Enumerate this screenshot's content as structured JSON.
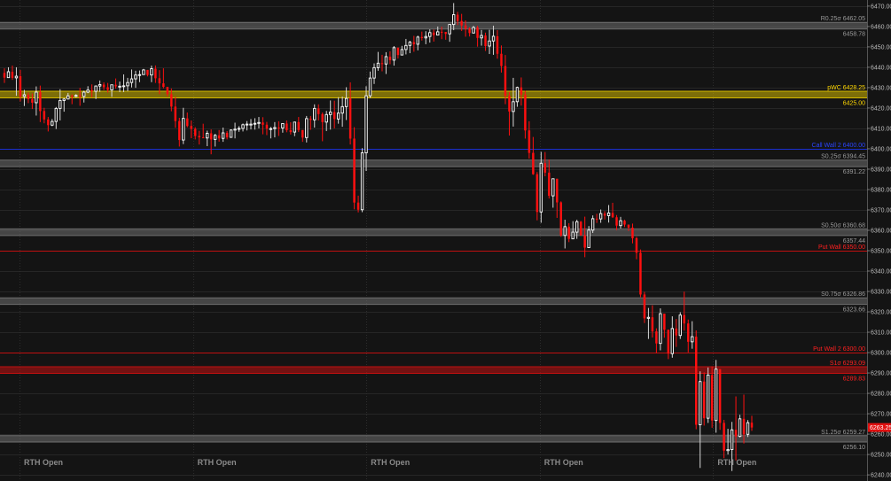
{
  "chart_data": {
    "type": "candlestick",
    "ylim": [
      6237,
      6473
    ],
    "y_ticks": [
      6470,
      6460,
      6450,
      6440,
      6430,
      6420,
      6410,
      6400,
      6390,
      6380,
      6370,
      6360,
      6350,
      6340,
      6330,
      6320,
      6310,
      6300,
      6290,
      6280,
      6270,
      6260,
      6250,
      6240
    ],
    "y_tick_labels": [
      "6470.00",
      "6460.00",
      "6450.00",
      "6440.00",
      "6430.00",
      "6420.00",
      "6410.00",
      "6400.00",
      "6390.00",
      "6380.00",
      "6370.00",
      "6360.00",
      "6350.00",
      "6340.00",
      "6330.00",
      "6320.00",
      "6310.00",
      "6300.00",
      "6290.00",
      "6280.00",
      "6270.00",
      "6260.00",
      "6250.00",
      "6240.00"
    ],
    "last_price": 6263.25,
    "last_price_label": "6263.25",
    "grid": true,
    "session_label": "RTH Open",
    "session_count": 5,
    "levels": [
      {
        "label": "R0.25σ  6462.05",
        "value": 6462.05,
        "color": "#6e6e6e",
        "kind": "band",
        "band_to": 6458.78,
        "text_color": "#9a9a9a"
      },
      {
        "label": "6458.78",
        "value": 6458.78,
        "color": "#6e6e6e",
        "kind": "label",
        "text_color": "#9a9a9a"
      },
      {
        "label": "pWC  6428.25",
        "value": 6428.25,
        "color": "#d4b800",
        "kind": "band",
        "band_to": 6425.0,
        "text_color": "#ffd700"
      },
      {
        "label": "6425.00",
        "value": 6425.0,
        "color": "#d4b800",
        "kind": "label",
        "text_color": "#ffd700"
      },
      {
        "label": "Call Wall 2  6400.00",
        "value": 6400.0,
        "color": "#1a2fd0",
        "kind": "line",
        "text_color": "#2a44ff"
      },
      {
        "label": "S0.25σ  6394.45",
        "value": 6394.45,
        "color": "#6e6e6e",
        "kind": "band",
        "band_to": 6391.22,
        "text_color": "#9a9a9a"
      },
      {
        "label": "6391.22",
        "value": 6391.22,
        "color": "#6e6e6e",
        "kind": "label",
        "text_color": "#9a9a9a"
      },
      {
        "label": "S0.50σ  6360.68",
        "value": 6360.68,
        "color": "#6e6e6e",
        "kind": "band",
        "band_to": 6357.44,
        "text_color": "#9a9a9a"
      },
      {
        "label": "6357.44",
        "value": 6357.44,
        "color": "#6e6e6e",
        "kind": "label",
        "text_color": "#9a9a9a"
      },
      {
        "label": "Put Wall  6350.00",
        "value": 6350.0,
        "color": "#c01010",
        "kind": "line",
        "text_color": "#ff2020"
      },
      {
        "label": "S0.75σ  6326.86",
        "value": 6326.86,
        "color": "#6e6e6e",
        "kind": "band",
        "band_to": 6323.66,
        "text_color": "#9a9a9a"
      },
      {
        "label": "6323.66",
        "value": 6323.66,
        "color": "#6e6e6e",
        "kind": "label",
        "text_color": "#9a9a9a"
      },
      {
        "label": "Put Wall 2  6300.00",
        "value": 6300.0,
        "color": "#c01010",
        "kind": "line",
        "text_color": "#ff2020"
      },
      {
        "label": "S1σ  6293.09",
        "value": 6293.09,
        "color": "#c01010",
        "kind": "band",
        "band_to": 6289.83,
        "text_color": "#ff2020"
      },
      {
        "label": "6289.83",
        "value": 6289.83,
        "color": "#c01010",
        "kind": "label",
        "text_color": "#ff2020"
      },
      {
        "label": "S1.25σ  6259.27",
        "value": 6259.27,
        "color": "#6e6e6e",
        "kind": "band",
        "band_to": 6256.1,
        "text_color": "#9a9a9a"
      },
      {
        "label": "6256.10",
        "value": 6256.1,
        "color": "#6e6e6e",
        "kind": "label",
        "text_color": "#9a9a9a"
      }
    ],
    "candles": [
      [
        6437.2,
        6439.5,
        6432.3,
        6434.9
      ],
      [
        6434.9,
        6440.0,
        6434.9,
        6437.8
      ],
      [
        6437.8,
        6440.8,
        6433.8,
        6434.8
      ],
      [
        6434.8,
        6440.0,
        6426.0,
        6435.6
      ],
      [
        6435.6,
        6438.7,
        6423.2,
        6425.7
      ],
      [
        6425.7,
        6428.9,
        6421.0,
        6426.5
      ],
      [
        6426.5,
        6427.6,
        6422.4,
        6424.4
      ],
      [
        6424.4,
        6427.1,
        6419.5,
        6422.6
      ],
      [
        6422.6,
        6430.6,
        6416.3,
        6427.8
      ],
      [
        6427.8,
        6431.0,
        6413.1,
        6418.5
      ],
      [
        6418.5,
        6420.1,
        6412.5,
        6414.4
      ],
      [
        6414.4,
        6415.6,
        6408.5,
        6411.6
      ],
      [
        6411.6,
        6414.6,
        6411.1,
        6413.4
      ],
      [
        6413.4,
        6420.5,
        6409.7,
        6419.8
      ],
      [
        6419.8,
        6429.2,
        6413.9,
        6423.7
      ],
      [
        6423.7,
        6424.9,
        6418.2,
        6424.4
      ],
      [
        6424.4,
        6427.4,
        6424.3,
        6426.0
      ],
      [
        6426.0,
        6426.7,
        6421.9,
        6425.7
      ],
      [
        6425.7,
        6426.8,
        6425.3,
        6426.2
      ],
      [
        6426.2,
        6429.9,
        6421.1,
        6425.7
      ],
      [
        6425.7,
        6428.5,
        6422.7,
        6427.8
      ],
      [
        6427.8,
        6430.7,
        6427.3,
        6428.8
      ],
      [
        6428.8,
        6431.6,
        6425.3,
        6428.2
      ],
      [
        6428.2,
        6431.1,
        6424.4,
        6430.8
      ],
      [
        6430.8,
        6433.5,
        6427.9,
        6431.5
      ],
      [
        6431.5,
        6432.6,
        6428.8,
        6430.2
      ],
      [
        6430.2,
        6432.3,
        6427.6,
        6428.9
      ],
      [
        6428.9,
        6431.5,
        6425.5,
        6431.4
      ],
      [
        6431.4,
        6434.5,
        6429.5,
        6430.6
      ],
      [
        6430.6,
        6433.0,
        6427.8,
        6430.7
      ],
      [
        6430.7,
        6436.5,
        6427.8,
        6430.9
      ],
      [
        6430.9,
        6434.8,
        6428.3,
        6432.5
      ],
      [
        6432.5,
        6438.9,
        6430.1,
        6434.3
      ],
      [
        6434.3,
        6438.3,
        6429.9,
        6436.2
      ],
      [
        6436.2,
        6438.4,
        6432.7,
        6436.4
      ],
      [
        6436.4,
        6439.2,
        6436.4,
        6438.7
      ],
      [
        6438.7,
        6438.7,
        6435.5,
        6436.2
      ],
      [
        6436.2,
        6440.8,
        6432.7,
        6439.3
      ],
      [
        6439.3,
        6440.9,
        6432.3,
        6434.6
      ],
      [
        6434.6,
        6438.6,
        6426.8,
        6432.1
      ],
      [
        6432.1,
        6439.5,
        6429.6,
        6430.4
      ],
      [
        6430.4,
        6430.4,
        6425.6,
        6426.8
      ],
      [
        6426.8,
        6429.6,
        6418.4,
        6420.7
      ],
      [
        6420.7,
        6425.5,
        6410.3,
        6413.6
      ],
      [
        6413.6,
        6415.2,
        6401.1,
        6404.3
      ],
      [
        6404.3,
        6420.1,
        6402.3,
        6414.9
      ],
      [
        6414.9,
        6417.8,
        6410.5,
        6411.2
      ],
      [
        6411.2,
        6413.9,
        6405.2,
        6409.8
      ],
      [
        6409.8,
        6410.6,
        6404.6,
        6406.3
      ],
      [
        6406.3,
        6408.8,
        6402.1,
        6405.6
      ],
      [
        6405.6,
        6412.3,
        6405.3,
        6405.3
      ],
      [
        6405.3,
        6408.9,
        6401.3,
        6407.6
      ],
      [
        6407.6,
        6409.5,
        6397.3,
        6404.6
      ],
      [
        6404.6,
        6407.3,
        6401.1,
        6406.6
      ],
      [
        6406.6,
        6409.2,
        6403.5,
        6405.1
      ],
      [
        6405.1,
        6410.4,
        6403.4,
        6407.8
      ],
      [
        6407.8,
        6408.7,
        6404.6,
        6405.6
      ],
      [
        6405.6,
        6409.5,
        6405.5,
        6409.2
      ],
      [
        6409.2,
        6412.8,
        6405.1,
        6409.6
      ],
      [
        6409.6,
        6411.1,
        6408.3,
        6410.0
      ],
      [
        6410.0,
        6412.4,
        6408.5,
        6411.8
      ],
      [
        6411.8,
        6413.6,
        6409.0,
        6412.1
      ],
      [
        6412.1,
        6414.6,
        6409.5,
        6412.1
      ],
      [
        6412.1,
        6415.0,
        6409.4,
        6412.5
      ],
      [
        6412.5,
        6415.6,
        6410.0,
        6412.9
      ],
      [
        6412.9,
        6415.5,
        6407.1,
        6411.8
      ],
      [
        6411.8,
        6413.2,
        6406.7,
        6409.9
      ],
      [
        6409.9,
        6410.7,
        6405.1,
        6409.9
      ],
      [
        6409.9,
        6413.1,
        6405.6,
        6410.4
      ],
      [
        6410.4,
        6413.5,
        6406.3,
        6410.2
      ],
      [
        6410.2,
        6412.4,
        6407.9,
        6412.4
      ],
      [
        6412.4,
        6413.9,
        6408.1,
        6409.1
      ],
      [
        6409.1,
        6413.0,
        6407.0,
        6408.2
      ],
      [
        6408.2,
        6413.1,
        6406.2,
        6413.1
      ],
      [
        6413.1,
        6415.6,
        6408.2,
        6409.2
      ],
      [
        6409.2,
        6409.2,
        6403.4,
        6405.5
      ],
      [
        6405.5,
        6416.1,
        6403.1,
        6414.8
      ],
      [
        6414.8,
        6416.1,
        6409.3,
        6414.2
      ],
      [
        6414.2,
        6421.8,
        6410.4,
        6419.8
      ],
      [
        6419.8,
        6421.8,
        6413.9,
        6417.0
      ],
      [
        6417.0,
        6417.8,
        6403.7,
        6413.1
      ],
      [
        6413.1,
        6418.6,
        6408.7,
        6416.8
      ],
      [
        6416.8,
        6423.7,
        6409.4,
        6418.0
      ],
      [
        6418.0,
        6423.6,
        6410.0,
        6414.6
      ],
      [
        6414.6,
        6425.3,
        6412.3,
        6417.5
      ],
      [
        6417.5,
        6425.6,
        6410.8,
        6420.7
      ],
      [
        6420.7,
        6430.2,
        6414.1,
        6424.7
      ],
      [
        6424.7,
        6432.6,
        6402.1,
        6405.0
      ],
      [
        6405.0,
        6410.6,
        6370.3,
        6373.6
      ],
      [
        6373.6,
        6377.0,
        6368.8,
        6370.1
      ],
      [
        6370.1,
        6400.3,
        6368.9,
        6398.0
      ],
      [
        6398.0,
        6430.7,
        6389.1,
        6426.0
      ],
      [
        6426.0,
        6437.9,
        6424.9,
        6434.7
      ],
      [
        6434.7,
        6441.9,
        6431.8,
        6439.8
      ],
      [
        6439.8,
        6447.5,
        6438.3,
        6442.0
      ],
      [
        6442.0,
        6446.1,
        6438.0,
        6441.6
      ],
      [
        6441.6,
        6447.4,
        6436.7,
        6445.2
      ],
      [
        6445.2,
        6447.8,
        6441.5,
        6443.5
      ],
      [
        6443.5,
        6450.4,
        6440.8,
        6449.6
      ],
      [
        6449.6,
        6449.7,
        6444.3,
        6446.0
      ],
      [
        6446.0,
        6450.5,
        6446.0,
        6448.7
      ],
      [
        6448.7,
        6453.9,
        6446.3,
        6450.7
      ],
      [
        6450.7,
        6453.0,
        6446.9,
        6452.3
      ],
      [
        6452.3,
        6455.4,
        6447.6,
        6451.3
      ],
      [
        6451.3,
        6455.5,
        6448.3,
        6454.8
      ],
      [
        6454.8,
        6457.5,
        6453.1,
        6454.4
      ],
      [
        6454.4,
        6457.7,
        6451.3,
        6455.1
      ],
      [
        6455.1,
        6458.6,
        6452.1,
        6457.0
      ],
      [
        6457.0,
        6458.5,
        6452.6,
        6455.8
      ],
      [
        6455.8,
        6460.0,
        6455.8,
        6457.4
      ],
      [
        6457.4,
        6459.9,
        6453.8,
        6457.3
      ],
      [
        6457.3,
        6457.3,
        6453.5,
        6456.4
      ],
      [
        6456.4,
        6461.0,
        6452.5,
        6461.0
      ],
      [
        6461.0,
        6471.5,
        6458.2,
        6465.8
      ],
      [
        6465.8,
        6467.2,
        6460.7,
        6462.7
      ],
      [
        6462.7,
        6466.2,
        6457.8,
        6460.5
      ],
      [
        6460.5,
        6463.0,
        6455.0,
        6459.0
      ],
      [
        6459.0,
        6459.6,
        6455.1,
        6456.8
      ],
      [
        6456.8,
        6460.3,
        6456.6,
        6459.5
      ],
      [
        6459.5,
        6460.4,
        6450.1,
        6454.4
      ],
      [
        6454.4,
        6458.3,
        6450.6,
        6455.6
      ],
      [
        6455.6,
        6457.0,
        6448.0,
        6450.4
      ],
      [
        6450.4,
        6458.4,
        6446.5,
        6452.9
      ],
      [
        6452.9,
        6460.4,
        6446.1,
        6455.2
      ],
      [
        6455.2,
        6458.2,
        6444.2,
        6446.6
      ],
      [
        6446.6,
        6450.7,
        6437.4,
        6440.6
      ],
      [
        6440.6,
        6446.0,
        6421.9,
        6426.0
      ],
      [
        6426.0,
        6427.9,
        6406.5,
        6418.3
      ],
      [
        6418.3,
        6434.8,
        6410.9,
        6423.1
      ],
      [
        6423.1,
        6430.5,
        6420.6,
        6430.1
      ],
      [
        6430.1,
        6435.0,
        6421.2,
        6426.6
      ],
      [
        6426.6,
        6428.4,
        6405.0,
        6409.0
      ],
      [
        6409.0,
        6413.5,
        6395.2,
        6398.0
      ],
      [
        6398.0,
        6405.8,
        6387.2,
        6387.5
      ],
      [
        6387.5,
        6388.6,
        6364.9,
        6369.0
      ],
      [
        6369.0,
        6398.5,
        6363.7,
        6392.9
      ],
      [
        6392.9,
        6398.4,
        6386.5,
        6388.3
      ],
      [
        6388.3,
        6394.7,
        6375.6,
        6376.9
      ],
      [
        6376.9,
        6385.3,
        6371.1,
        6385.3
      ],
      [
        6385.3,
        6385.3,
        6366.1,
        6373.7
      ],
      [
        6373.7,
        6374.2,
        6356.8,
        6357.5
      ],
      [
        6357.5,
        6365.2,
        6351.1,
        6361.8
      ],
      [
        6361.8,
        6363.5,
        6354.2,
        6355.8
      ],
      [
        6355.8,
        6364.5,
        6355.8,
        6359.1
      ],
      [
        6359.1,
        6365.2,
        6355.8,
        6364.2
      ],
      [
        6364.2,
        6364.6,
        6357.5,
        6357.5
      ],
      [
        6357.5,
        6366.7,
        6346.8,
        6351.5
      ],
      [
        6351.5,
        6362.1,
        6351.5,
        6360.1
      ],
      [
        6360.1,
        6367.3,
        6358.7,
        6365.7
      ],
      [
        6365.7,
        6368.1,
        6363.6,
        6365.6
      ],
      [
        6365.6,
        6370.2,
        6363.7,
        6368.2
      ],
      [
        6368.2,
        6369.4,
        6365.3,
        6367.2
      ],
      [
        6367.2,
        6372.4,
        6363.8,
        6368.5
      ],
      [
        6368.5,
        6373.5,
        6366.1,
        6366.4
      ],
      [
        6366.4,
        6367.5,
        6360.1,
        6362.3
      ],
      [
        6362.3,
        6366.6,
        6360.9,
        6364.7
      ],
      [
        6364.7,
        6365.2,
        6361.6,
        6362.8
      ],
      [
        6362.8,
        6362.8,
        6359.7,
        6361.3
      ],
      [
        6361.3,
        6363.3,
        6353.6,
        6356.1
      ],
      [
        6356.1,
        6356.8,
        6345.8,
        6349.0
      ],
      [
        6349.0,
        6350.6,
        6327.2,
        6328.5
      ],
      [
        6328.5,
        6329.8,
        6314.5,
        6316.8
      ],
      [
        6316.8,
        6321.9,
        6306.7,
        6317.3
      ],
      [
        6317.3,
        6323.2,
        6307.4,
        6310.4
      ],
      [
        6310.4,
        6311.9,
        6299.8,
        6304.5
      ],
      [
        6304.5,
        6321.7,
        6301.1,
        6319.1
      ],
      [
        6319.1,
        6319.1,
        6307.3,
        6311.2
      ],
      [
        6311.2,
        6311.2,
        6296.8,
        6299.5
      ],
      [
        6299.5,
        6317.8,
        6297.5,
        6311.8
      ],
      [
        6311.8,
        6316.5,
        6302.8,
        6308.4
      ],
      [
        6308.4,
        6319.8,
        6306.7,
        6318.4
      ],
      [
        6318.4,
        6329.9,
        6310.8,
        6314.3
      ],
      [
        6314.3,
        6316.2,
        6300.1,
        6305.3
      ],
      [
        6305.3,
        6315.4,
        6301.9,
        6307.8
      ],
      [
        6307.8,
        6310.9,
        6262.4,
        6264.6
      ],
      [
        6264.6,
        6290.8,
        6243.4,
        6285.8
      ],
      [
        6285.8,
        6290.3,
        6264.2,
        6267.8
      ],
      [
        6267.8,
        6292.7,
        6265.5,
        6289.0
      ],
      [
        6289.0,
        6293.3,
        6263.1,
        6266.7
      ],
      [
        6266.7,
        6296.4,
        6260.7,
        6291.9
      ],
      [
        6291.9,
        6291.9,
        6262.1,
        6265.5
      ],
      [
        6265.5,
        6267.0,
        6248.2,
        6251.9
      ],
      [
        6251.9,
        6262.6,
        6250.0,
        6252.4
      ],
      [
        6252.4,
        6266.0,
        6241.9,
        6262.1
      ],
      [
        6262.1,
        6278.5,
        6247.1,
        6258.9
      ],
      [
        6258.9,
        6269.5,
        6258.4,
        6267.5
      ],
      [
        6267.5,
        6279.4,
        6255.4,
        6259.9
      ],
      [
        6259.9,
        6266.9,
        6258.6,
        6265.6
      ],
      [
        6265.6,
        6269.0,
        6261.6,
        6263.25
      ]
    ]
  }
}
